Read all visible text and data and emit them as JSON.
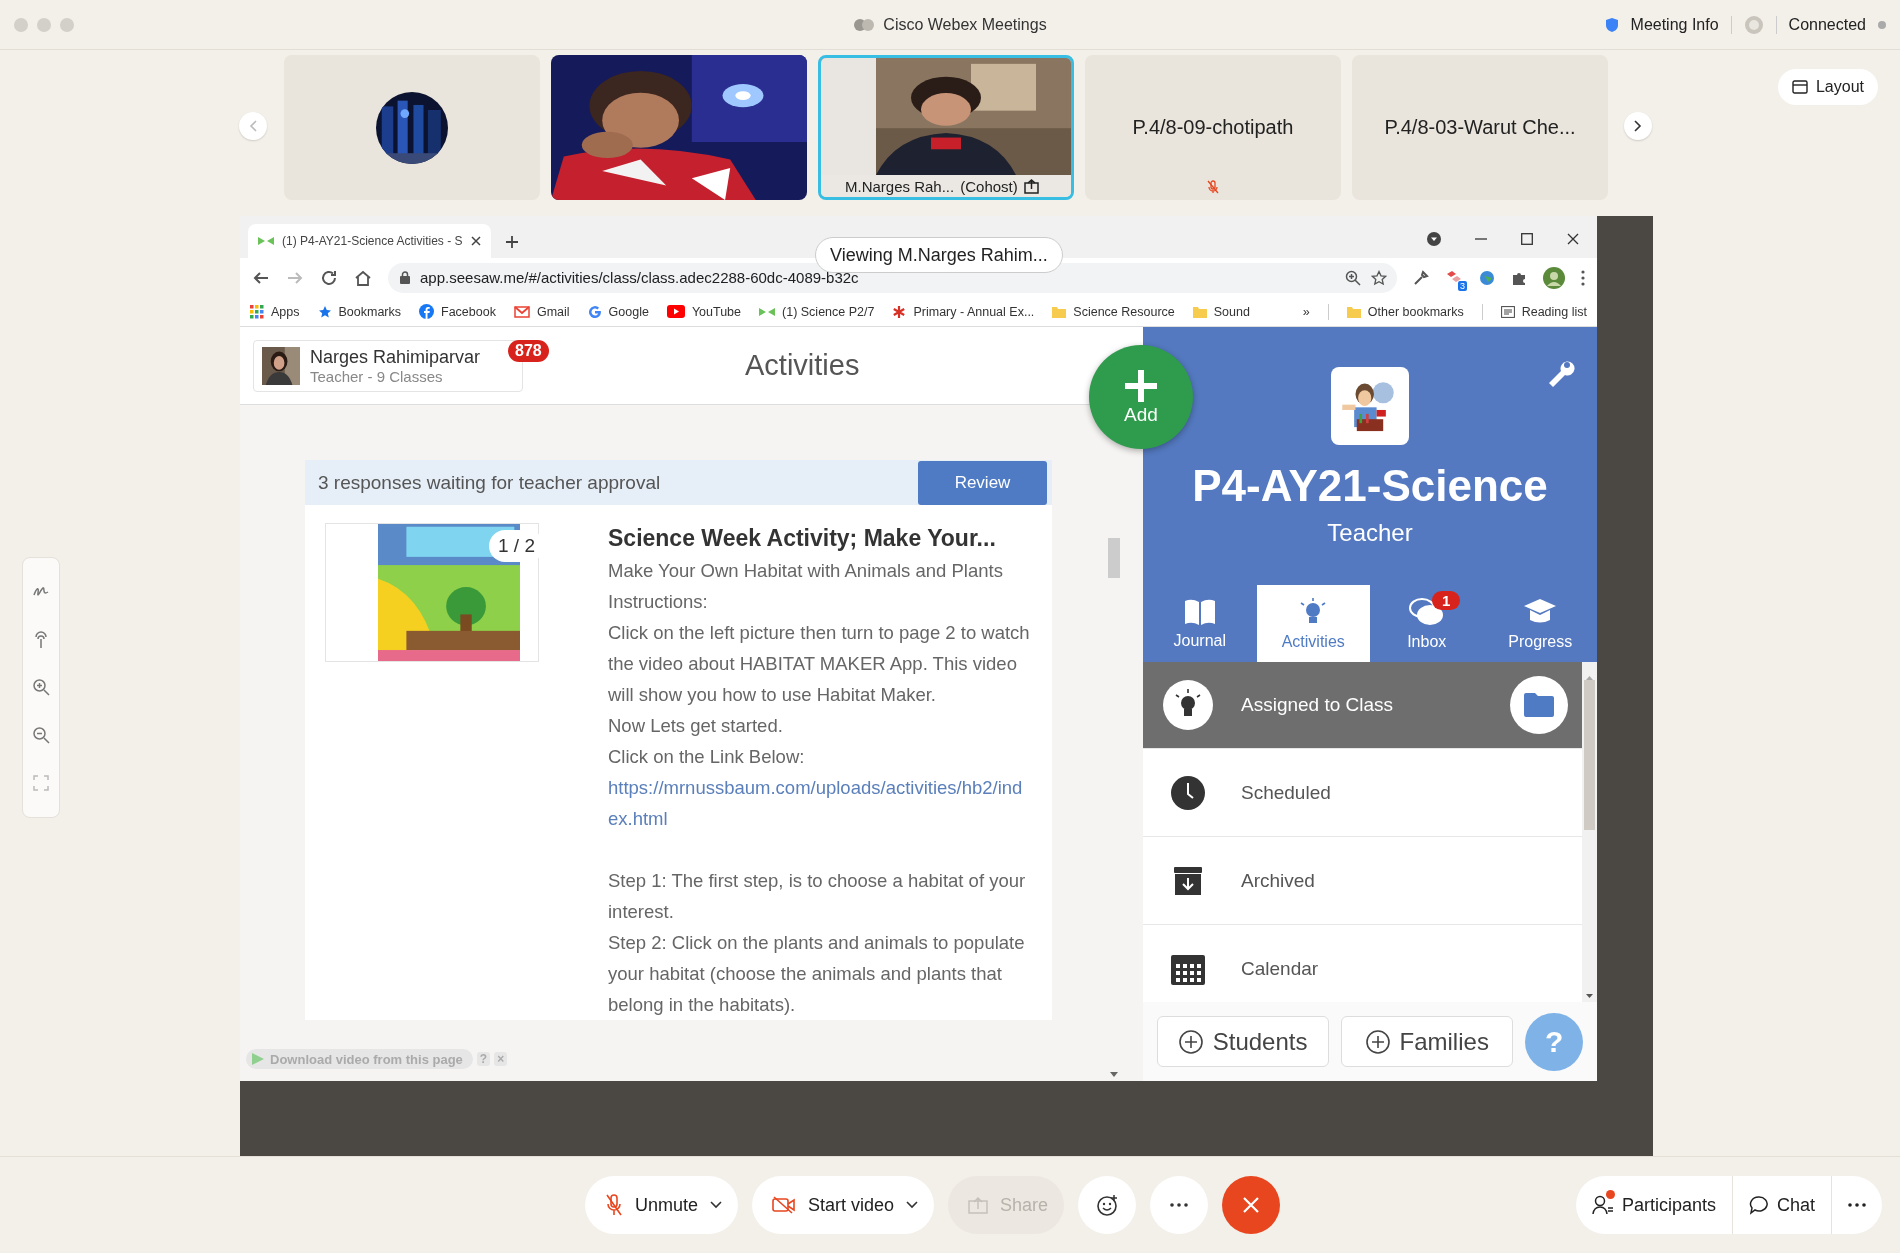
{
  "window": {
    "title": "Cisco Webex Meetings",
    "meeting_info": "Meeting Info",
    "status": "Connected"
  },
  "tiles": [
    {
      "kind": "avatar",
      "selected": false
    },
    {
      "kind": "video",
      "selected": false
    },
    {
      "kind": "video",
      "selected": true,
      "name": "M.Narges Rah...",
      "role": "(Cohost)",
      "sharing": true
    },
    {
      "kind": "name",
      "selected": false,
      "name": "P.4/8-09-chotipath",
      "muted": true
    },
    {
      "kind": "name",
      "selected": false,
      "name": "P.4/8-03-Warut Che...",
      "muted": false
    }
  ],
  "layout_button": "Layout",
  "viewing_label": "Viewing M.Narges Rahim...",
  "browser": {
    "tab_title": "(1) P4-AY21-Science Activities - S",
    "url": "app.seesaw.me/#/activities/class/class.adec2288-60dc-4089-b32c",
    "extension_badge": "3",
    "bookmarks": [
      {
        "kind": "apps",
        "label": "Apps"
      },
      {
        "kind": "star",
        "label": "Bookmarks"
      },
      {
        "kind": "facebook",
        "label": "Facebook"
      },
      {
        "kind": "gmail",
        "label": "Gmail"
      },
      {
        "kind": "google",
        "label": "Google"
      },
      {
        "kind": "youtube",
        "label": "YouTube"
      },
      {
        "kind": "seesaw",
        "label": "(1) Science P2/7"
      },
      {
        "kind": "asterisk",
        "label": "Primary - Annual Ex..."
      },
      {
        "kind": "folder",
        "label": "Science Resource"
      },
      {
        "kind": "folder",
        "label": "Sound"
      }
    ],
    "bookmarks_overflow": "»",
    "other_bookmarks": "Other bookmarks",
    "reading_list": "Reading list"
  },
  "seesaw": {
    "profile": {
      "name": "Narges Rahimiparvar",
      "subtitle": "Teacher - 9 Classes",
      "badge": "878"
    },
    "page_title": "Activities",
    "add_label": "Add",
    "banner": {
      "text": "3 responses waiting for teacher approval",
      "button": "Review"
    },
    "activity": {
      "title": "Science Week Activity; Make Your...",
      "pages": "1 / 2",
      "description": [
        {
          "kind": "text",
          "text": "Make Your Own Habitat with Animals and Plants"
        },
        {
          "kind": "text",
          "text": "Instructions:"
        },
        {
          "kind": "text",
          "text": "Click on the left picture then turn to page 2 to watch the video about HABITAT MAKER App. This video will show you how to use Habitat Maker."
        },
        {
          "kind": "text",
          "text": "Now Lets get started."
        },
        {
          "kind": "text",
          "text": "Click on the Link Below:"
        },
        {
          "kind": "link",
          "text": "https://mrnussbaum.com/uploads/activities/hb2/index.html"
        },
        {
          "kind": "gap"
        },
        {
          "kind": "text",
          "text": "Step 1: The first step, is to choose a habitat of your interest."
        },
        {
          "kind": "text",
          "text": "Step 2: Click on the plants and animals to populate your habitat (choose the animals and plants that belong in the habitats)."
        }
      ]
    },
    "download_bar": {
      "label": "Download video from this page",
      "help": "?",
      "close": "×"
    },
    "class_panel": {
      "name": "P4-AY21-Science",
      "role": "Teacher",
      "tabs": [
        {
          "kind": "journal",
          "label": "Journal",
          "selected": false
        },
        {
          "kind": "activities",
          "label": "Activities",
          "selected": true
        },
        {
          "kind": "inbox",
          "label": "Inbox",
          "selected": false,
          "badge": "1"
        },
        {
          "kind": "progress",
          "label": "Progress",
          "selected": false
        }
      ],
      "folders": [
        {
          "kind": "lightbulb",
          "label": "Assigned to Class",
          "selected": true
        },
        {
          "kind": "clock",
          "label": "Scheduled",
          "selected": false
        },
        {
          "kind": "archive",
          "label": "Archived",
          "selected": false
        },
        {
          "kind": "calendar",
          "label": "Calendar",
          "selected": false
        }
      ],
      "buttons": [
        {
          "label": "Students"
        },
        {
          "label": "Families"
        }
      ],
      "help": "?"
    }
  },
  "controls": [
    {
      "kind": "mic",
      "label": "Unmute",
      "disabled": false
    },
    {
      "kind": "video",
      "label": "Start video",
      "disabled": false
    },
    {
      "kind": "share",
      "label": "Share",
      "disabled": true
    },
    {
      "kind": "reactions",
      "disabled": false
    },
    {
      "kind": "more",
      "disabled": false
    },
    {
      "kind": "leave",
      "disabled": false
    }
  ],
  "side_controls": [
    {
      "kind": "participants",
      "label": "Participants",
      "alert": true
    },
    {
      "kind": "chat",
      "label": "Chat",
      "alert": false
    },
    {
      "kind": "more",
      "alert": false
    }
  ]
}
